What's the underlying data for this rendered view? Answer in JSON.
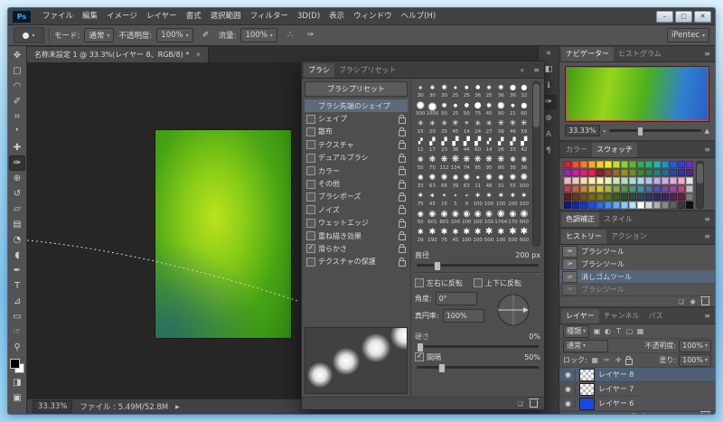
{
  "ui": {
    "caret": "▾",
    "menu_icon": "≡",
    "close_icon": "✕",
    "collapse_icon": "«",
    "collapse_r_icon": "»",
    "check_icon": "✓",
    "arrow_icon": "▶",
    "min_icon": "–",
    "max_icon": "▢",
    "eye_icon": "◉",
    "tri_small": "▴",
    "tri_big": "▲",
    "fx_label": "fx"
  },
  "menubar": {
    "logo": "Ps",
    "items": [
      "ファイル",
      "編集",
      "イメージ",
      "レイヤー",
      "書式",
      "選択範囲",
      "フィルター",
      "3D(D)",
      "表示",
      "ウィンドウ",
      "ヘルプ(H)"
    ]
  },
  "options": {
    "mode_label": "モード:",
    "mode_value": "通常",
    "opacity_label": "不透明度:",
    "opacity_value": "100%",
    "flow_label": "流量:",
    "flow_value": "100%",
    "pressure_icon": "✐",
    "airbrush_icon": "∴",
    "pressure2_icon": "✑",
    "workspace": "iPentec"
  },
  "toolbar": {
    "tools": [
      {
        "name": "move-tool",
        "g": "✥"
      },
      {
        "name": "marquee-tool",
        "g": "▢"
      },
      {
        "name": "lasso-tool",
        "g": "◠"
      },
      {
        "name": "quick-selection-tool",
        "g": "✐"
      },
      {
        "name": "crop-tool",
        "g": "⌗"
      },
      {
        "name": "eyedropper-tool",
        "g": "❜"
      },
      {
        "name": "healing-brush-tool",
        "g": "✚"
      },
      {
        "name": "brush-tool",
        "g": "✑",
        "cls": "sel"
      },
      {
        "name": "clone-stamp-tool",
        "g": "⊕"
      },
      {
        "name": "history-brush-tool",
        "g": "↺"
      },
      {
        "name": "eraser-tool",
        "g": "▱"
      },
      {
        "name": "gradient-tool",
        "g": "▤"
      },
      {
        "name": "blur-tool",
        "g": "◔"
      },
      {
        "name": "dodge-tool",
        "g": "◖"
      },
      {
        "name": "pen-tool",
        "g": "✒"
      },
      {
        "name": "type-tool",
        "g": "T"
      },
      {
        "name": "path-selection-tool",
        "g": "⊿"
      },
      {
        "name": "shape-tool",
        "g": "▭"
      },
      {
        "name": "hand-tool",
        "g": "☞"
      },
      {
        "name": "zoom-tool",
        "g": "⚲"
      }
    ],
    "quick_mask": "◨",
    "screen_mode": "▣"
  },
  "doc_tab": {
    "title": "名称未設定 1 @ 33.3%(レイヤー 8、RGB/8) *"
  },
  "dock": {
    "icons": [
      {
        "name": "expand-dock-icon",
        "g": "«"
      },
      {
        "name": "properties-panel-icon",
        "g": "◧"
      },
      {
        "name": "info-panel-icon",
        "g": "ℹ"
      },
      {
        "name": "brush-panel-icon",
        "g": "✑",
        "cls": "sel"
      },
      {
        "name": "clone-source-panel-icon",
        "g": "⊕"
      },
      {
        "name": "character-panel-icon",
        "g": "A"
      },
      {
        "name": "paragraph-panel-icon",
        "g": "¶"
      }
    ]
  },
  "brush_panel": {
    "tabs": [
      {
        "label": "ブラシ",
        "cls": "act"
      },
      {
        "label": "ブラシプリセット",
        "cls": "inact"
      }
    ],
    "preset_button": "ブラシプリセット",
    "options": [
      {
        "label": "ブラシ先端のシェイプ",
        "cls": "sel nobox"
      },
      {
        "label": "シェイプ",
        "cls": "lock"
      },
      {
        "label": "散布",
        "cls": "lock"
      },
      {
        "label": "テクスチャ",
        "cls": "lock"
      },
      {
        "label": "デュアルブラシ",
        "cls": "lock"
      },
      {
        "label": "カラー",
        "cls": "lock"
      },
      {
        "label": "その他",
        "cls": "lock"
      },
      {
        "label": "ブラシポーズ",
        "cls": "lock"
      },
      {
        "label": "ノイズ",
        "cls": "lock"
      },
      {
        "label": "ウェットエッジ",
        "cls": "lock"
      },
      {
        "label": "重ね描き効果",
        "cls": "lock"
      },
      {
        "label": "滑らかさ",
        "cls": "lock checked"
      },
      {
        "label": "テクスチャの保護",
        "cls": "lock"
      }
    ],
    "grid": [
      {
        "n": "30",
        "g": "●",
        "cls": "soft z4"
      },
      {
        "n": "30",
        "g": "●",
        "cls": "soft z5"
      },
      {
        "n": "30",
        "g": "●",
        "cls": "soft z6"
      },
      {
        "n": "25",
        "g": "●",
        "cls": "z4"
      },
      {
        "n": "25",
        "g": "●",
        "cls": "z5"
      },
      {
        "n": "36",
        "g": "●",
        "cls": "z6"
      },
      {
        "n": "25",
        "g": "●",
        "cls": "soft z5"
      },
      {
        "n": "36",
        "g": "●",
        "cls": "soft z6"
      },
      {
        "n": "36",
        "g": "●",
        "cls": "z7"
      },
      {
        "n": "32",
        "g": "●",
        "cls": "z7"
      },
      {
        "n": "500",
        "g": "●",
        "cls": "soft z9"
      },
      {
        "n": "1000",
        "g": "●",
        "cls": "soft z10"
      },
      {
        "n": "50",
        "g": "●",
        "cls": "soft z6"
      },
      {
        "n": "25",
        "g": "●",
        "cls": "z5"
      },
      {
        "n": "50",
        "g": "●",
        "cls": "z6"
      },
      {
        "n": "75",
        "g": "●",
        "cls": "z8"
      },
      {
        "n": "45",
        "g": "●",
        "cls": "soft z6"
      },
      {
        "n": "90",
        "g": "●",
        "cls": "soft z8"
      },
      {
        "n": "21",
        "g": "●",
        "cls": "z5"
      },
      {
        "n": "60",
        "g": "●",
        "cls": "z7"
      },
      {
        "n": "15",
        "g": "✳",
        "cls": "z7"
      },
      {
        "n": "20",
        "g": "✳",
        "cls": "z7"
      },
      {
        "n": "25",
        "g": "✳",
        "cls": "z7"
      },
      {
        "n": "45",
        "g": "✳",
        "cls": "z8"
      },
      {
        "n": "14",
        "g": "✳",
        "cls": "z6"
      },
      {
        "n": "24",
        "g": "✳",
        "cls": "z7"
      },
      {
        "n": "27",
        "g": "✳",
        "cls": "z7"
      },
      {
        "n": "39",
        "g": "✳",
        "cls": "z8"
      },
      {
        "n": "46",
        "g": "✳",
        "cls": "z8"
      },
      {
        "n": "59",
        "g": "✳",
        "cls": "z8"
      },
      {
        "n": "11",
        "g": "▞",
        "cls": "z6"
      },
      {
        "n": "17",
        "g": "▞",
        "cls": "z7"
      },
      {
        "n": "23",
        "g": "▞",
        "cls": "z7"
      },
      {
        "n": "36",
        "g": "▞",
        "cls": "z8"
      },
      {
        "n": "44",
        "g": "▞",
        "cls": "z8"
      },
      {
        "n": "60",
        "g": "▞",
        "cls": "z8"
      },
      {
        "n": "14",
        "g": "▞",
        "cls": "z6"
      },
      {
        "n": "26",
        "g": "▞",
        "cls": "z7"
      },
      {
        "n": "33",
        "g": "▞",
        "cls": "z7"
      },
      {
        "n": "42",
        "g": "▞",
        "cls": "z8"
      },
      {
        "n": "55",
        "g": "❋",
        "cls": "z7"
      },
      {
        "n": "70",
        "g": "❋",
        "cls": "z8"
      },
      {
        "n": "112",
        "g": "❋",
        "cls": "z8"
      },
      {
        "n": "134",
        "g": "❋",
        "cls": "z9"
      },
      {
        "n": "74",
        "g": "❋",
        "cls": "z8"
      },
      {
        "n": "95",
        "g": "❋",
        "cls": "z8"
      },
      {
        "n": "95",
        "g": "❋",
        "cls": "z8"
      },
      {
        "n": "90",
        "g": "❋",
        "cls": "z8"
      },
      {
        "n": "36",
        "g": "❋",
        "cls": "z7"
      },
      {
        "n": "36",
        "g": "❋",
        "cls": "z7"
      },
      {
        "n": "33",
        "g": "✺",
        "cls": "z7"
      },
      {
        "n": "63",
        "g": "✺",
        "cls": "z8"
      },
      {
        "n": "66",
        "g": "✺",
        "cls": "z8"
      },
      {
        "n": "39",
        "g": "✺",
        "cls": "z7"
      },
      {
        "n": "63",
        "g": "✺",
        "cls": "z8"
      },
      {
        "n": "11",
        "g": "✺",
        "cls": "z5"
      },
      {
        "n": "48",
        "g": "✺",
        "cls": "z8"
      },
      {
        "n": "32",
        "g": "✺",
        "cls": "z7"
      },
      {
        "n": "55",
        "g": "✺",
        "cls": "z8"
      },
      {
        "n": "100",
        "g": "✺",
        "cls": "z9"
      },
      {
        "n": "75",
        "g": "✶",
        "cls": "z8"
      },
      {
        "n": "45",
        "g": "✶",
        "cls": "z7"
      },
      {
        "n": "15",
        "g": "✶",
        "cls": "z6"
      },
      {
        "n": "5",
        "g": "✶",
        "cls": "z5"
      },
      {
        "n": "9",
        "g": "✶",
        "cls": "z5"
      },
      {
        "n": "100",
        "g": "✶",
        "cls": "z8"
      },
      {
        "n": "100",
        "g": "✶",
        "cls": "z8"
      },
      {
        "n": "100",
        "g": "✶",
        "cls": "z8"
      },
      {
        "n": "100",
        "g": "✶",
        "cls": "z8"
      },
      {
        "n": "100",
        "g": "✶",
        "cls": "z8"
      },
      {
        "n": "50",
        "g": "◉",
        "cls": "z7"
      },
      {
        "n": "601",
        "g": "◉",
        "cls": "z8"
      },
      {
        "n": "601",
        "g": "◉",
        "cls": "z8"
      },
      {
        "n": "100",
        "g": "◉",
        "cls": "z8"
      },
      {
        "n": "100",
        "g": "◉",
        "cls": "z8"
      },
      {
        "n": "100",
        "g": "◉",
        "cls": "z8"
      },
      {
        "n": "100",
        "g": "◉",
        "cls": "z8"
      },
      {
        "n": "1764",
        "g": "◉",
        "cls": "z9"
      },
      {
        "n": "170",
        "g": "◉",
        "cls": "z8"
      },
      {
        "n": "500",
        "g": "◉",
        "cls": "z9"
      },
      {
        "n": "29",
        "g": "✱",
        "cls": "z7"
      },
      {
        "n": "192",
        "g": "✱",
        "cls": "z8"
      },
      {
        "n": "75",
        "g": "✱",
        "cls": "z8"
      },
      {
        "n": "45",
        "g": "✱",
        "cls": "z7"
      },
      {
        "n": "100",
        "g": "✱",
        "cls": "z8"
      },
      {
        "n": "100",
        "g": "✱",
        "cls": "z8"
      },
      {
        "n": "500",
        "g": "✱",
        "cls": "z9"
      },
      {
        "n": "100",
        "g": "✱",
        "cls": "z8"
      },
      {
        "n": "500",
        "g": "✱",
        "cls": "z9"
      },
      {
        "n": "500",
        "g": "✱",
        "cls": "z9"
      }
    ],
    "diameter_label": "直径",
    "diameter_value": "200 px",
    "flip_x": "左右に反転",
    "flip_y": "上下に反転",
    "angle_label": "角度:",
    "angle_value": "0°",
    "round_label": "真円率:",
    "round_value": "100%",
    "hard_label": "硬さ",
    "hard_value": "0%",
    "space_label": "間隔",
    "space_value": "50%",
    "foot_icons": [
      {
        "name": "new-brush-icon",
        "g": "❏"
      },
      {
        "name": "delete-brush-icon",
        "g": "",
        "cls": "trashic"
      }
    ]
  },
  "navigator": {
    "tabs": [
      {
        "label": "ナビゲーター",
        "cls": "act"
      },
      {
        "label": "ヒストグラム",
        "cls": "inact"
      }
    ],
    "zoom": "33.33%"
  },
  "color": {
    "tabs": [
      {
        "label": "カラー",
        "cls": "inact"
      },
      {
        "label": "スウォッチ",
        "cls": "act"
      }
    ],
    "swatches": [
      "#d6213b",
      "#e8552e",
      "#f27f29",
      "#f6a821",
      "#f8ce1e",
      "#f5ec1b",
      "#c5e01e",
      "#8ed322",
      "#57c025",
      "#2bb24a",
      "#25b47e",
      "#22b5b0",
      "#2292c8",
      "#2360d8",
      "#3b3bd0",
      "#6b2fc6",
      "#9a27b8",
      "#c522a0",
      "#e01f78",
      "#ea1f4e",
      "#8c1f2f",
      "#97452a",
      "#9a6b28",
      "#9a8f26",
      "#6f8f26",
      "#45832a",
      "#2c7f55",
      "#297f7c",
      "#276a94",
      "#2a4aa0",
      "#35359a",
      "#4f2a88",
      "#f4b8c2",
      "#f7c9b4",
      "#fadcae",
      "#fdeea9",
      "#fdf7a6",
      "#ecf5ac",
      "#cfeab0",
      "#b3e0b6",
      "#a9dfd0",
      "#a8dbe8",
      "#aec4ea",
      "#b8b0e6",
      "#cfaee2",
      "#e4addc",
      "#f0adc8",
      "#e6e6e6",
      "#b04a5a",
      "#b86a4a",
      "#c08a44",
      "#c8aa40",
      "#ccc23e",
      "#a8ba44",
      "#7aa84a",
      "#54964e",
      "#4a9678",
      "#4a8ea0",
      "#4a6ea8",
      "#5454a8",
      "#744aa0",
      "#964a98",
      "#ae4a7e",
      "#bfbfbf",
      "#5c1f28",
      "#643a22",
      "#6c521f",
      "#74691d",
      "#787420",
      "#5c6c22",
      "#3e5c26",
      "#2c4e2a",
      "#284e40",
      "#284a56",
      "#283a5e",
      "#2c2c60",
      "#3e2458",
      "#54224e",
      "#5e2240",
      "#7a7a7a",
      "#101d7a",
      "#14299e",
      "#1838c2",
      "#2050e2",
      "#2c6cf0",
      "#3f8cf4",
      "#5cacf6",
      "#84c8f8",
      "#b0e0fa",
      "#ffffff",
      "#d8d8d8",
      "#b0b0b0",
      "#888888",
      "#606060",
      "#383838",
      "#101010"
    ]
  },
  "adjust": {
    "tabs": [
      {
        "label": "色調補正",
        "cls": "act"
      },
      {
        "label": "スタイル",
        "cls": "inact"
      }
    ]
  },
  "history": {
    "tabs": [
      {
        "label": "ヒストリー",
        "cls": "act"
      },
      {
        "label": "アクション",
        "cls": "inact"
      }
    ],
    "items": [
      {
        "g": "✑",
        "label": "ブラシツール"
      },
      {
        "g": "✑",
        "label": "ブラシツール"
      },
      {
        "g": "▱",
        "label": "消しゴムツール",
        "cls": "sel"
      },
      {
        "g": "✑",
        "label": "ブラシツール",
        "cls": "dim"
      }
    ],
    "foot_icons": [
      {
        "name": "new-doc-from-state-icon",
        "g": "❏"
      },
      {
        "name": "new-snapshot-icon",
        "g": "◉"
      },
      {
        "name": "delete-state-icon",
        "g": "",
        "cls": "trashic"
      }
    ]
  },
  "layers": {
    "tabs": [
      {
        "label": "レイヤー",
        "cls": "act"
      },
      {
        "label": "チャンネル",
        "cls": "inact"
      },
      {
        "label": "パス",
        "cls": "inact"
      }
    ],
    "filter_label": "種類",
    "filter_icons": [
      {
        "name": "filter-pixel-icon",
        "g": "▣"
      },
      {
        "name": "filter-adjustment-icon",
        "g": "◐"
      },
      {
        "name": "filter-type-icon",
        "g": "T"
      },
      {
        "name": "filter-shape-icon",
        "g": "▢"
      },
      {
        "name": "filter-smart-icon",
        "g": "▦"
      }
    ],
    "blend_mode": "通常",
    "opacity_label": "不透明度:",
    "opacity_value": "100%",
    "lock_label": "ロック:",
    "lock_icons": [
      {
        "name": "lock-transparency-icon",
        "g": "▦"
      },
      {
        "name": "lock-pixels-icon",
        "g": "✑"
      },
      {
        "name": "lock-position-icon",
        "g": "✛"
      },
      {
        "name": "lock-all-icon",
        "g": "",
        "cls": "lockglyph"
      }
    ],
    "fill_label": "塗り:",
    "fill_value": "100%",
    "rows": [
      {
        "label": "レイヤー 8",
        "cls": "sel t-checker"
      },
      {
        "label": "レイヤー 7",
        "cls": "t-checker"
      },
      {
        "label": "レイヤー 6",
        "cls": "t-blue"
      }
    ],
    "foot_icons": [
      {
        "name": "link-layers-icon",
        "g": "⧉"
      },
      {
        "name": "layer-style-icon",
        "g": "fx"
      },
      {
        "name": "layer-mask-icon",
        "g": "◧"
      },
      {
        "name": "adjustment-layer-icon",
        "g": "◐"
      },
      {
        "name": "layer-group-icon",
        "g": "▭"
      },
      {
        "name": "new-layer-icon",
        "g": "❏"
      },
      {
        "name": "delete-layer-icon",
        "g": "",
        "cls": "trashic"
      }
    ]
  },
  "status": {
    "zoom": "33.33%",
    "file": "ファイル : 5.49M/52.8M"
  }
}
